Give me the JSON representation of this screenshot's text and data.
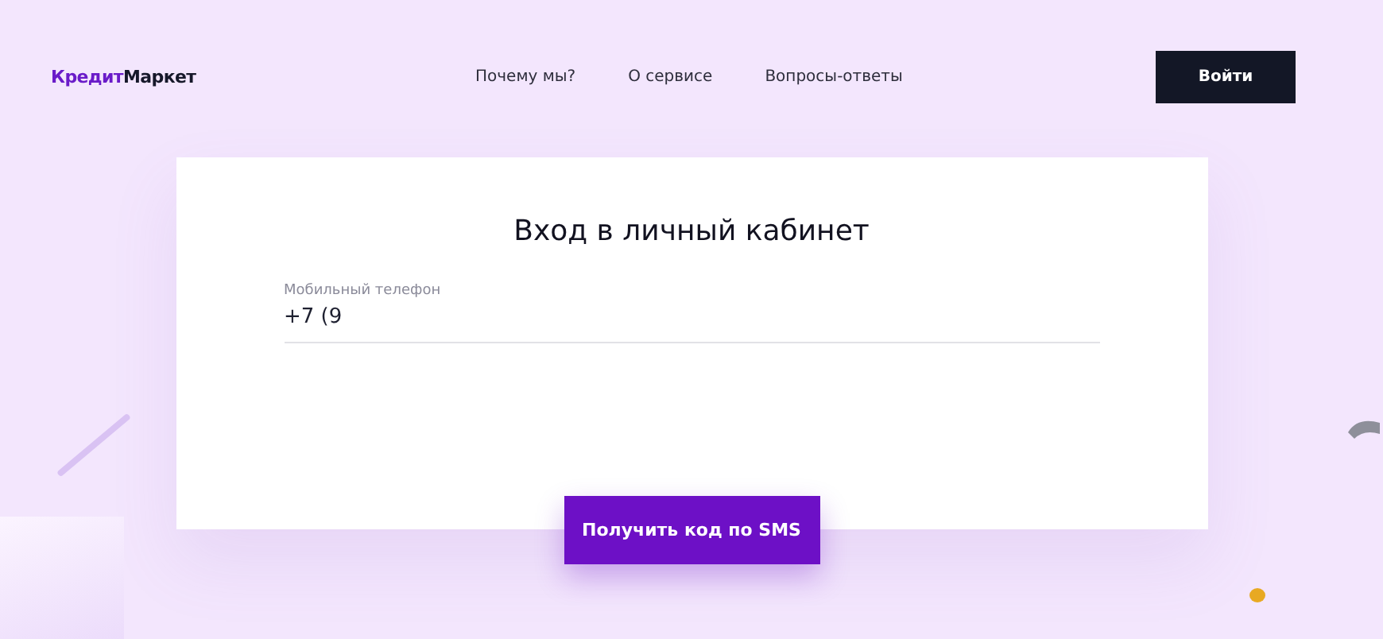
{
  "logo": {
    "primary": "Кредит",
    "secondary": "Маркет"
  },
  "nav": [
    "Почему мы?",
    "О сервисе",
    "Вопросы-ответы"
  ],
  "login_button": "Войти",
  "card": {
    "title": "Вход в личный кабинет",
    "phone": {
      "label": "Мобильный телефон",
      "value": "+7 (9"
    }
  },
  "submit_button": "Получить код по SMS"
}
